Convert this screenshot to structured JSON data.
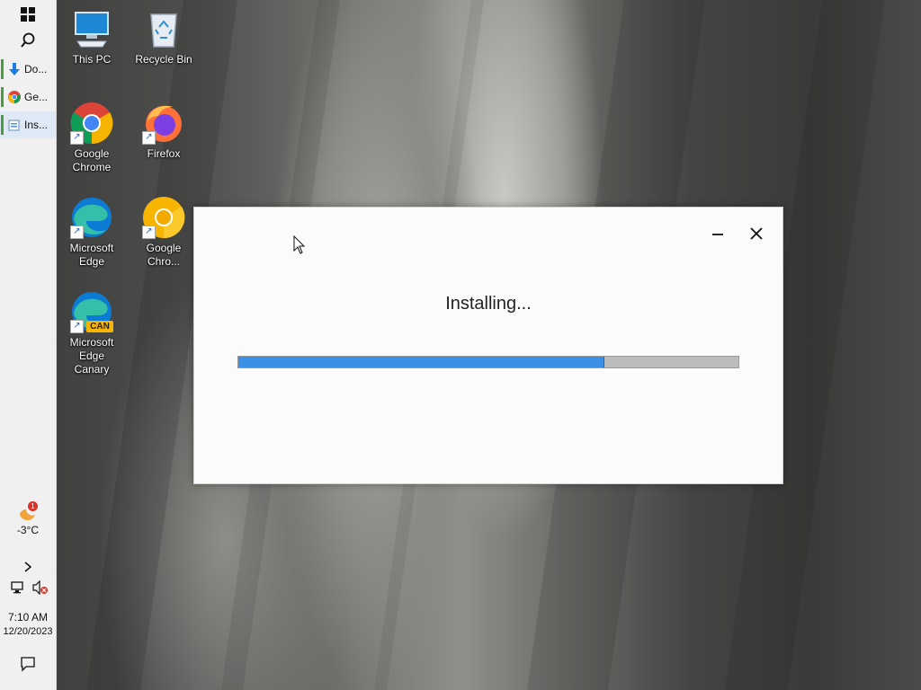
{
  "taskbar": {
    "apps": [
      {
        "label": "Do...",
        "icon": "download-icon"
      },
      {
        "label": "Ge...",
        "icon": "chrome-icon"
      },
      {
        "label": "Ins...",
        "icon": "installer-icon"
      }
    ],
    "weather": {
      "badge": "1",
      "temp": "-3°C"
    },
    "clock": {
      "time": "7:10 AM",
      "date": "12/20/2023"
    }
  },
  "desktop": {
    "icons": [
      {
        "label": "This PC",
        "icon": "this-pc-icon"
      },
      {
        "label": "Recycle Bin",
        "icon": "recycle-bin-icon"
      },
      {
        "label": "Google Chrome",
        "icon": "chrome-icon"
      },
      {
        "label": "Firefox",
        "icon": "firefox-icon"
      },
      {
        "label": "Microsoft Edge",
        "icon": "edge-icon"
      },
      {
        "label": "Google Chro...",
        "icon": "chrome-canary-icon"
      },
      {
        "label": "Microsoft Edge Canary",
        "icon": "edge-canary-icon",
        "badge": "CAN"
      }
    ]
  },
  "installer": {
    "status": "Installing...",
    "progress": 0.73
  },
  "colors": {
    "accent": "#3c8fe3",
    "taskbar_bg": "#f0f0f0"
  }
}
